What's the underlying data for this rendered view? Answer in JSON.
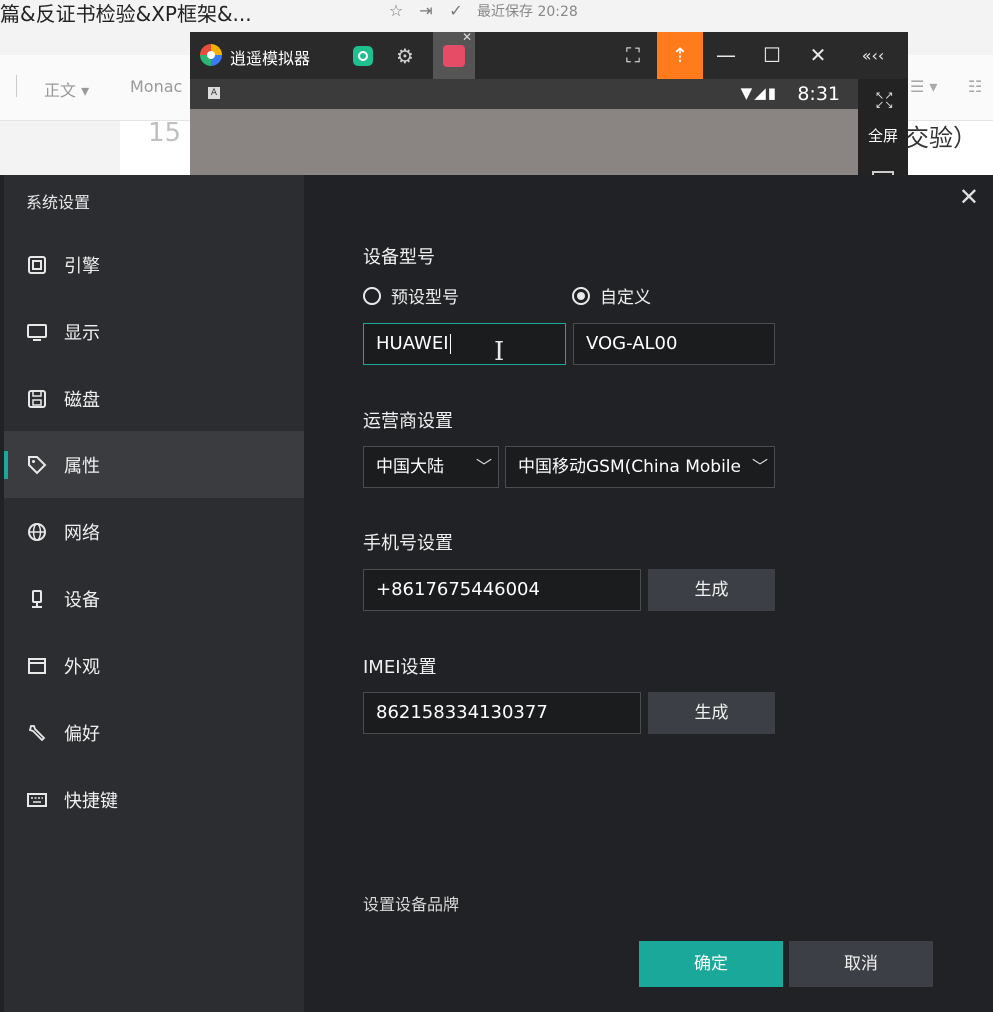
{
  "document": {
    "title": "篇&反证书检验&XP框架&...",
    "saved_status": "最近保存 20:28",
    "toolbar_style": "正文",
    "toolbar_font": "Monac",
    "line_number": "15",
    "line_tail": "交验）"
  },
  "emulator": {
    "name": "逍遥模拟器",
    "time": "8:31",
    "fullscreen_label": "全屏",
    "collapse_label": "«‹‹"
  },
  "dialog": {
    "title": "系统设置",
    "nav": [
      {
        "label": "引擎",
        "icon": "cpu-icon"
      },
      {
        "label": "显示",
        "icon": "monitor-icon"
      },
      {
        "label": "磁盘",
        "icon": "disk-icon"
      },
      {
        "label": "属性",
        "icon": "tag-icon",
        "active": true
      },
      {
        "label": "网络",
        "icon": "globe-icon"
      },
      {
        "label": "设备",
        "icon": "microphone-icon"
      },
      {
        "label": "外观",
        "icon": "window-icon"
      },
      {
        "label": "偏好",
        "icon": "wrench-icon"
      },
      {
        "label": "快捷键",
        "icon": "keyboard-icon"
      }
    ],
    "device_model": {
      "label": "设备型号",
      "option_preset": "预设型号",
      "option_custom": "自定义",
      "selected": "自定义",
      "brand_value": "HUAWEI",
      "model_value": "VOG-AL00"
    },
    "carrier": {
      "label": "运营商设置",
      "region": "中国大陆",
      "operator": "中国移动GSM(China Mobile"
    },
    "phone": {
      "label": "手机号设置",
      "value": "+8617675446004",
      "generate": "生成"
    },
    "imei": {
      "label": "IMEI设置",
      "value": "862158334130377",
      "generate": "生成"
    },
    "hint": "设置设备品牌",
    "ok": "确定",
    "cancel": "取消"
  },
  "colors": {
    "accent": "#1aa89a",
    "upload": "#ff7b1c",
    "dialog_bg": "#202225",
    "sidebar_bg": "#2b2d30"
  }
}
